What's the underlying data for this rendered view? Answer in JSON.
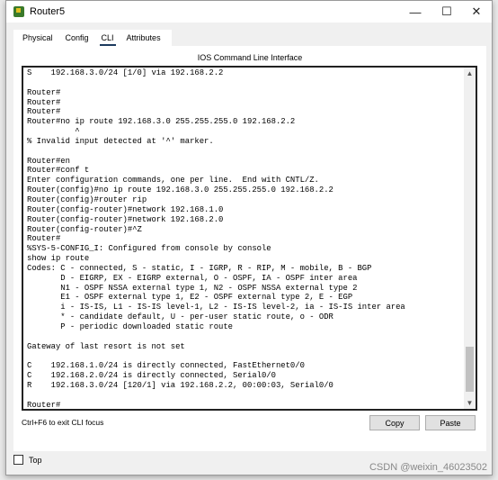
{
  "window": {
    "title": "Router5",
    "minimize": "—",
    "maximize": "☐",
    "close": "✕"
  },
  "tabs": [
    {
      "label": "Physical"
    },
    {
      "label": "Config"
    },
    {
      "label": "CLI",
      "active": true
    },
    {
      "label": "Attributes"
    }
  ],
  "cli": {
    "title": "IOS Command Line Interface",
    "output": "S    192.168.3.0/24 [1/0] via 192.168.2.2\n\nRouter#\nRouter#\nRouter#\nRouter#no ip route 192.168.3.0 255.255.255.0 192.168.2.2\n          ^\n% Invalid input detected at '^' marker.\n\nRouter#en\nRouter#conf t\nEnter configuration commands, one per line.  End with CNTL/Z.\nRouter(config)#no ip route 192.168.3.0 255.255.255.0 192.168.2.2\nRouter(config)#router rip\nRouter(config-router)#network 192.168.1.0\nRouter(config-router)#network 192.168.2.0\nRouter(config-router)#^Z\nRouter#\n%SYS-5-CONFIG_I: Configured from console by console\nshow ip route\nCodes: C - connected, S - static, I - IGRP, R - RIP, M - mobile, B - BGP\n       D - EIGRP, EX - EIGRP external, O - OSPF, IA - OSPF inter area\n       N1 - OSPF NSSA external type 1, N2 - OSPF NSSA external type 2\n       E1 - OSPF external type 1, E2 - OSPF external type 2, E - EGP\n       i - IS-IS, L1 - IS-IS level-1, L2 - IS-IS level-2, ia - IS-IS inter area\n       * - candidate default, U - per-user static route, o - ODR\n       P - periodic downloaded static route\n\nGateway of last resort is not set\n\nC    192.168.1.0/24 is directly connected, FastEthernet0/0\nC    192.168.2.0/24 is directly connected, Serial0/0\nR    192.168.3.0/24 [120/1] via 192.168.2.2, 00:00:03, Serial0/0\n\nRouter#",
    "hint": "Ctrl+F6 to exit CLI focus",
    "copy": "Copy",
    "paste": "Paste"
  },
  "top_checkbox": {
    "label": "Top",
    "checked": false
  },
  "watermark": "CSDN @weixin_46023502",
  "colors": {
    "active_tab_underline": "#1c3a5e"
  }
}
